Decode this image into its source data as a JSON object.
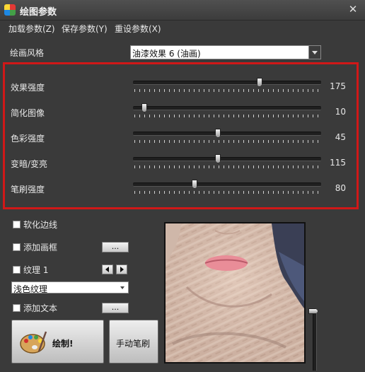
{
  "window": {
    "title": "绘图参数",
    "close_glyph": "✕"
  },
  "menu": [
    "加载参数(Z)",
    "保存参数(Y)",
    "重设参数(X)"
  ],
  "style": {
    "label": "绘画风格",
    "value": "油漆效果 6 (油画)"
  },
  "sliders": [
    {
      "label": "效果强度",
      "value": "175",
      "level": 0.68
    },
    {
      "label": "简化图像",
      "value": "10",
      "level": 0.04
    },
    {
      "label": "色彩强度",
      "value": "45",
      "level": 0.45
    },
    {
      "label": "变暗/变亮",
      "value": "115",
      "level": 0.45
    },
    {
      "label": "笔刷强度",
      "value": "80",
      "level": 0.32
    }
  ],
  "options": {
    "soften_edges": "软化边线",
    "add_frame": "添加画框",
    "frame_button": "...",
    "texture": "纹理 1",
    "texture_select": "浅色纹理",
    "add_text": "添加文本",
    "text_button": "..."
  },
  "buttons": {
    "paint": "绘制!",
    "manual_brush": "手动笔刷"
  },
  "colors": {
    "frame_highlight": "#d01818",
    "background": "#3a3a3a"
  }
}
